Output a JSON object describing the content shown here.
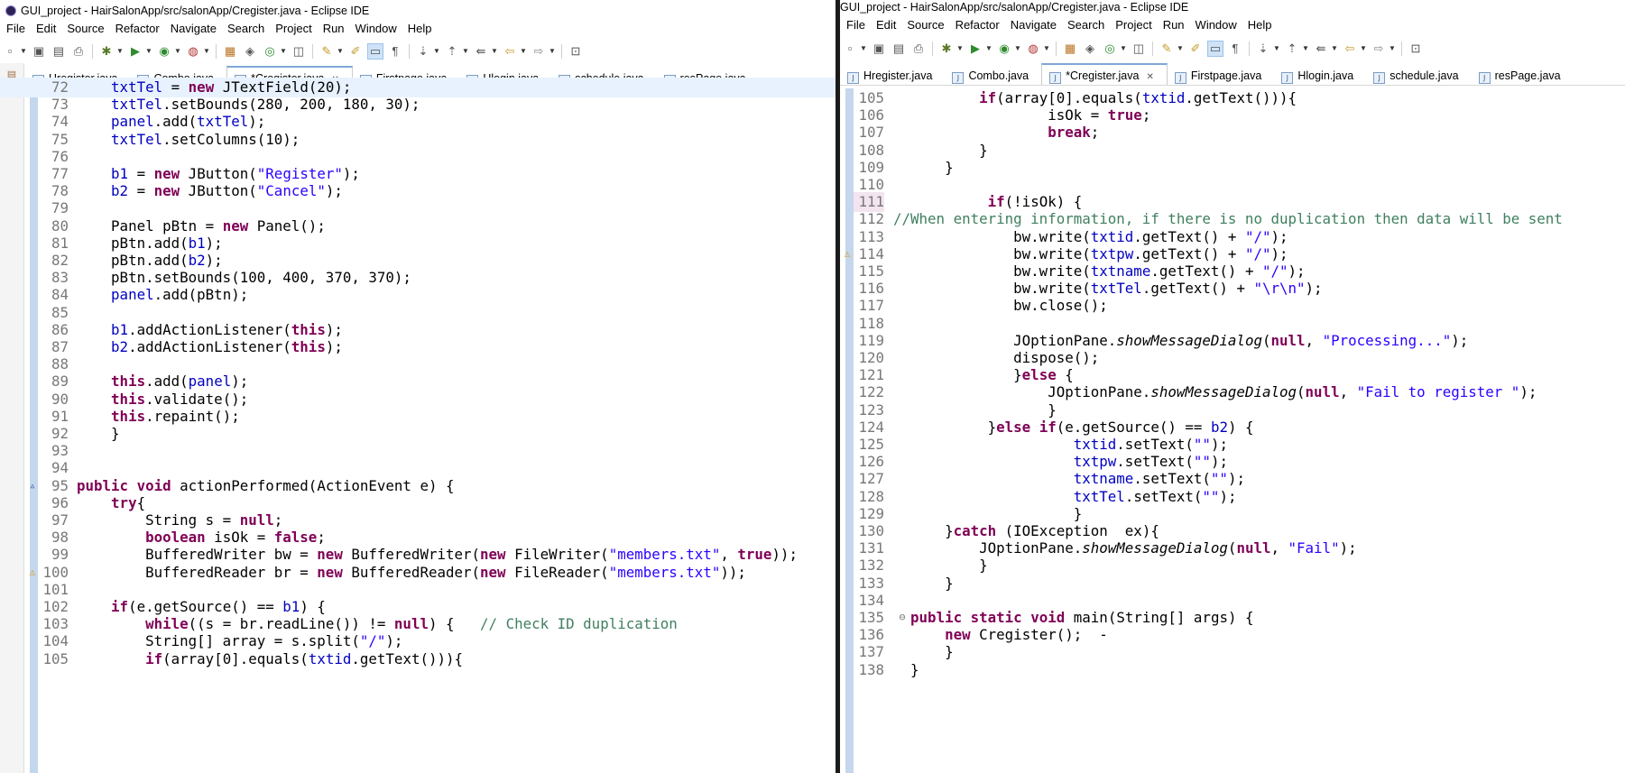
{
  "window_title": "GUI_project - HairSalonApp/src/salonApp/Cregister.java - Eclipse IDE",
  "menu": [
    "File",
    "Edit",
    "Source",
    "Refactor",
    "Navigate",
    "Search",
    "Project",
    "Run",
    "Window",
    "Help"
  ],
  "tabs": [
    "Hregister.java",
    "Combo.java",
    "*Cregister.java",
    "Firstpage.java",
    "Hlogin.java",
    "schedule.java",
    "resPage.java"
  ],
  "active_tab_index": 2,
  "left_code": [
    {
      "n": "72",
      "t": "    txtTel = new JTextField(20);"
    },
    {
      "n": "73",
      "t": "    txtTel.setBounds(280, 200, 180, 30);"
    },
    {
      "n": "74",
      "t": "    panel.add(txtTel);"
    },
    {
      "n": "75",
      "t": "    txtTel.setColumns(10);"
    },
    {
      "n": "76",
      "t": ""
    },
    {
      "n": "77",
      "t": "    b1 = new JButton(\"Register\");"
    },
    {
      "n": "78",
      "t": "    b2 = new JButton(\"Cancel\");"
    },
    {
      "n": "79",
      "t": ""
    },
    {
      "n": "80",
      "t": "    Panel pBtn = new Panel();"
    },
    {
      "n": "81",
      "t": "    pBtn.add(b1);"
    },
    {
      "n": "82",
      "t": "    pBtn.add(b2);"
    },
    {
      "n": "83",
      "t": "    pBtn.setBounds(100, 400, 370, 370);"
    },
    {
      "n": "84",
      "t": "    panel.add(pBtn);"
    },
    {
      "n": "85",
      "t": ""
    },
    {
      "n": "86",
      "t": "    b1.addActionListener(this);"
    },
    {
      "n": "87",
      "t": "    b2.addActionListener(this);"
    },
    {
      "n": "88",
      "t": ""
    },
    {
      "n": "89",
      "t": "    this.add(panel);"
    },
    {
      "n": "90",
      "t": "    this.validate();"
    },
    {
      "n": "91",
      "t": "    this.repaint();"
    },
    {
      "n": "92",
      "t": "    }"
    },
    {
      "n": "93",
      "t": ""
    },
    {
      "n": "94",
      "t": ""
    },
    {
      "n": "95",
      "t": "public void actionPerformed(ActionEvent e) {"
    },
    {
      "n": "96",
      "t": "    try{"
    },
    {
      "n": "97",
      "t": "        String s = null;"
    },
    {
      "n": "98",
      "t": "        boolean isOk = false;"
    },
    {
      "n": "99",
      "t": "        BufferedWriter bw = new BufferedWriter(new FileWriter(\"members.txt\", true));"
    },
    {
      "n": "100",
      "t": "        BufferedReader br = new BufferedReader(new FileReader(\"members.txt\"));"
    },
    {
      "n": "101",
      "t": ""
    },
    {
      "n": "102",
      "t": "    if(e.getSource() == b1) {"
    },
    {
      "n": "103",
      "t": "        while((s = br.readLine()) != null) {   // Check ID duplication"
    },
    {
      "n": "104",
      "t": "        String[] array = s.split(\"/\");"
    },
    {
      "n": "105",
      "t": "        if(array[0].equals(txtid.getText())){"
    }
  ],
  "right_code": [
    {
      "n": "105",
      "t": "          if(array[0].equals(txtid.getText())){"
    },
    {
      "n": "106",
      "t": "                  isOk = true;"
    },
    {
      "n": "107",
      "t": "                  break;"
    },
    {
      "n": "108",
      "t": "          }"
    },
    {
      "n": "109",
      "t": "      }"
    },
    {
      "n": "110",
      "t": ""
    },
    {
      "n": "111",
      "t": "           if(!isOk) {"
    },
    {
      "n": "112",
      "t": "//When entering information, if there is no duplication then data will be sent"
    },
    {
      "n": "113",
      "t": "              bw.write(txtid.getText() + \"/\");"
    },
    {
      "n": "114",
      "t": "              bw.write(txtpw.getText() + \"/\");"
    },
    {
      "n": "115",
      "t": "              bw.write(txtname.getText() + \"/\");"
    },
    {
      "n": "116",
      "t": "              bw.write(txtTel.getText() + \"\\r\\n\");"
    },
    {
      "n": "117",
      "t": "              bw.close();"
    },
    {
      "n": "118",
      "t": ""
    },
    {
      "n": "119",
      "t": "              JOptionPane.showMessageDialog(null, \"Processing...\");"
    },
    {
      "n": "120",
      "t": "              dispose();"
    },
    {
      "n": "121",
      "t": "              }else {"
    },
    {
      "n": "122",
      "t": "                  JOptionPane.showMessageDialog(null, \"Fail to register \");"
    },
    {
      "n": "123",
      "t": "                  }"
    },
    {
      "n": "124",
      "t": "           }else if(e.getSource() == b2) {"
    },
    {
      "n": "125",
      "t": "                     txtid.setText(\"\");"
    },
    {
      "n": "126",
      "t": "                     txtpw.setText(\"\");"
    },
    {
      "n": "127",
      "t": "                     txtname.setText(\"\");"
    },
    {
      "n": "128",
      "t": "                     txtTel.setText(\"\");"
    },
    {
      "n": "129",
      "t": "                     }"
    },
    {
      "n": "130",
      "t": "      }catch (IOException  ex){"
    },
    {
      "n": "131",
      "t": "          JOptionPane.showMessageDialog(null, \"Fail\");"
    },
    {
      "n": "132",
      "t": "          }"
    },
    {
      "n": "133",
      "t": "      }"
    },
    {
      "n": "134",
      "t": ""
    },
    {
      "n": "135",
      "t": "  public static void main(String[] args) {"
    },
    {
      "n": "136",
      "t": "      new Cregister();  -"
    },
    {
      "n": "137",
      "t": "      }"
    },
    {
      "n": "138",
      "t": "  }"
    }
  ],
  "colors": {
    "keyword": "#7f0055",
    "string": "#2a00ff",
    "comment": "#3f7f5f",
    "field": "#0000c0",
    "line_number": "#787878",
    "current_line": "#e8f2fe"
  },
  "icons": {
    "toolbar": [
      "new-icon",
      "save-icon",
      "save-all-icon",
      "print-icon",
      "debug-icon",
      "run-icon",
      "coverage-icon",
      "external-tools-icon",
      "new-java-project-icon",
      "new-package-icon",
      "new-class-icon",
      "open-type-icon",
      "search-icon",
      "toggle-mark-occurrences-icon",
      "block-selection-icon",
      "show-whitespace-icon",
      "next-annotation-icon",
      "previous-annotation-icon",
      "last-edit-icon",
      "back-icon",
      "forward-icon",
      "pin-editor-icon"
    ],
    "tab": "java-file-icon",
    "close": "close-icon"
  }
}
